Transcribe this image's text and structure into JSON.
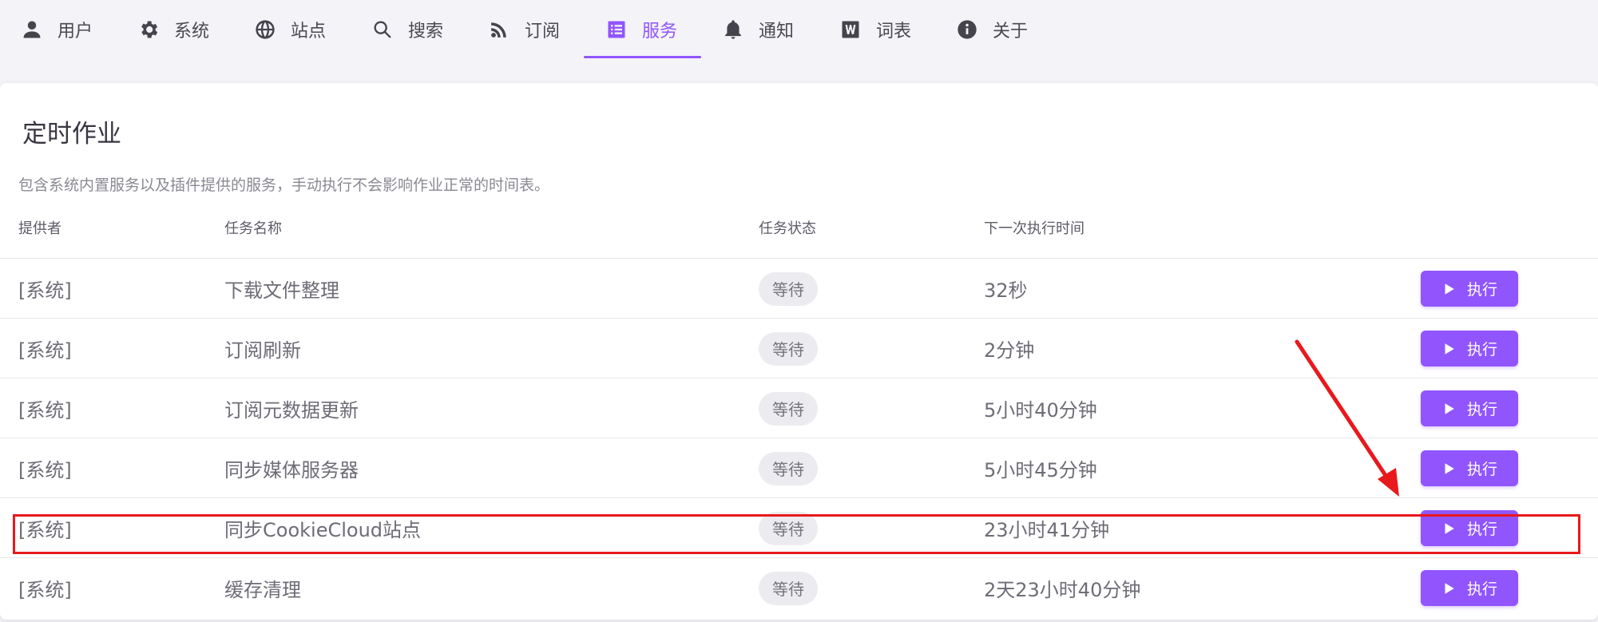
{
  "tabs": [
    {
      "label": "用户",
      "icon": "user-icon"
    },
    {
      "label": "系统",
      "icon": "gear-icon"
    },
    {
      "label": "站点",
      "icon": "globe-icon"
    },
    {
      "label": "搜索",
      "icon": "search-icon"
    },
    {
      "label": "订阅",
      "icon": "rss-icon"
    },
    {
      "label": "服务",
      "icon": "list-icon",
      "active": true
    },
    {
      "label": "通知",
      "icon": "bell-icon"
    },
    {
      "label": "词表",
      "icon": "word-icon"
    },
    {
      "label": "关于",
      "icon": "info-icon"
    }
  ],
  "card": {
    "title": "定时作业",
    "subtitle": "包含系统内置服务以及插件提供的服务，手动执行不会影响作业正常的时间表。"
  },
  "table": {
    "headers": [
      "提供者",
      "任务名称",
      "任务状态",
      "下一次执行时间"
    ],
    "rows": [
      {
        "provider": "[系统]",
        "name": "下载文件整理",
        "status": "等待",
        "next": "32秒",
        "action": "执行"
      },
      {
        "provider": "[系统]",
        "name": "订阅刷新",
        "status": "等待",
        "next": "2分钟",
        "action": "执行"
      },
      {
        "provider": "[系统]",
        "name": "订阅元数据更新",
        "status": "等待",
        "next": "5小时40分钟",
        "action": "执行"
      },
      {
        "provider": "[系统]",
        "name": "同步媒体服务器",
        "status": "等待",
        "next": "5小时45分钟",
        "action": "执行"
      },
      {
        "provider": "[系统]",
        "name": "同步CookieCloud站点",
        "status": "等待",
        "next": "23小时41分钟",
        "action": "执行"
      },
      {
        "provider": "[系统]",
        "name": "缓存清理",
        "status": "等待",
        "next": "2天23小时40分钟",
        "action": "执行"
      }
    ]
  },
  "colors": {
    "accent": "#9155fd",
    "annotation": "#e8191c"
  }
}
